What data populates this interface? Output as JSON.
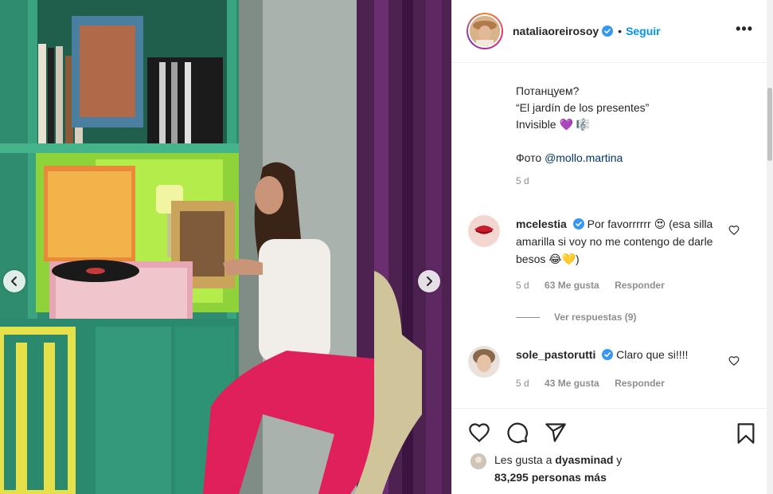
{
  "post": {
    "username": "nataliaoreirosoy",
    "follow_label": "Seguir",
    "more_label": "•••",
    "separator": "•"
  },
  "caption": {
    "line1": "Потанцуем?",
    "line2": "“El jardín de los presentes”",
    "line3": "Invisible 💜 🎼",
    "photo_credit_prefix": "Фото ",
    "photo_credit_mention": "@mollo.martina",
    "age": "5 d"
  },
  "comments": [
    {
      "user": "mcelestia",
      "text": "Por favorrrrrr 😍 (esa silla amarilla si voy no me contengo de darle besos 😂💛)",
      "age": "5 d",
      "likes": "63 Me gusta",
      "reply_label": "Responder"
    },
    {
      "user": "sole_pastorutti",
      "text": "Claro que si!!!!",
      "age": "5 d",
      "likes": "43 Me gusta",
      "reply_label": "Responder"
    }
  ],
  "view_replies": "Ver respuestas (9)",
  "likes": {
    "prefix": "Les gusta a ",
    "user": "dyasminad",
    "middle": " y",
    "count": "83,295 personas más"
  },
  "icons": {
    "prev": "chevron-left-icon",
    "next": "chevron-right-icon",
    "like": "heart-icon",
    "comment": "comment-icon",
    "share": "send-icon",
    "save": "bookmark-icon",
    "verified": "verified-badge-icon"
  },
  "colors": {
    "accent": "#0095f6",
    "verified": "#3897f0",
    "muted": "#8e8e8e"
  }
}
